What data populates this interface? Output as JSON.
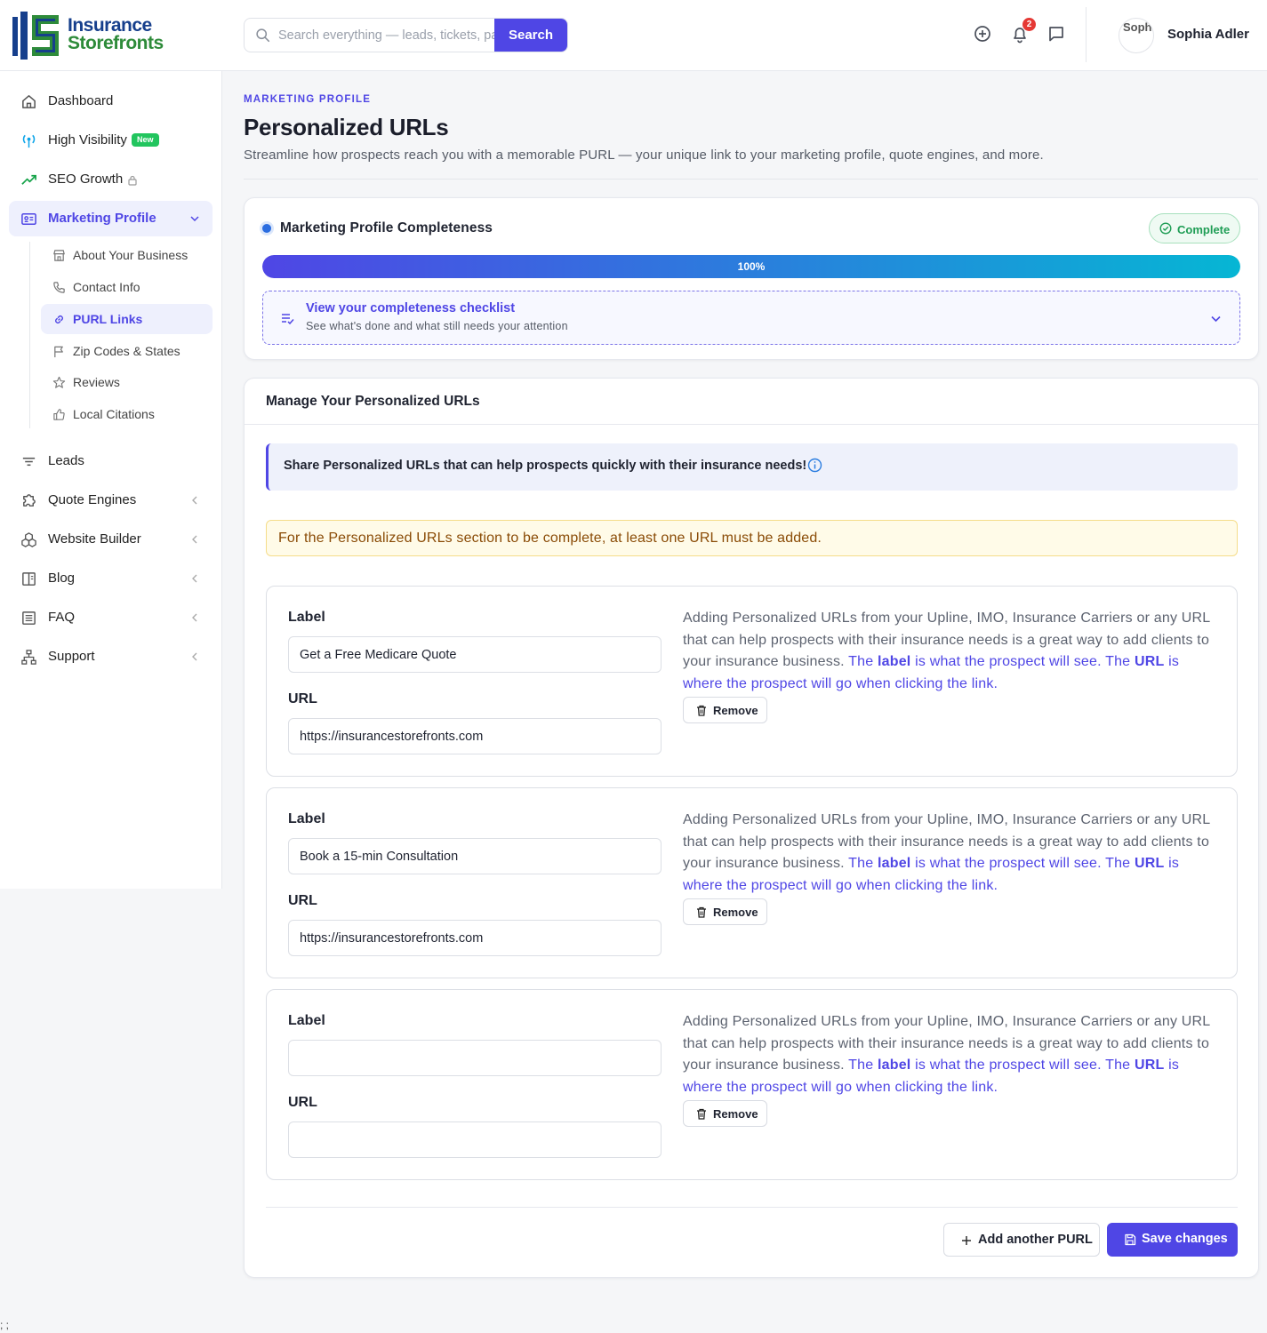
{
  "brand": {
    "line1": "Insurance",
    "line2": "Storefronts"
  },
  "search": {
    "placeholder": "Search everything — leads, tickets, pages",
    "button": "Search"
  },
  "header": {
    "notification_count": "2",
    "avatar_alt": "Sophia Adler",
    "user_name": "Sophia Adler"
  },
  "sidebar": {
    "items": [
      {
        "label": "Dashboard",
        "icon": "home-icon"
      },
      {
        "label": "High Visibility",
        "icon": "broadcast-icon",
        "badge": "New"
      },
      {
        "label": "SEO Growth",
        "icon": "trending-up-icon",
        "locked": true
      },
      {
        "label": "Marketing Profile",
        "icon": "id-card-icon",
        "active": true
      },
      {
        "label": "Leads",
        "icon": "filter-icon"
      },
      {
        "label": "Quote Engines",
        "icon": "puzzle-icon"
      },
      {
        "label": "Website Builder",
        "icon": "blocks-icon"
      },
      {
        "label": "Blog",
        "icon": "book-icon"
      },
      {
        "label": "FAQ",
        "icon": "list-icon"
      },
      {
        "label": "Support",
        "icon": "sitemap-icon"
      }
    ],
    "sub_items": [
      {
        "label": "About Your Business",
        "icon": "store-icon"
      },
      {
        "label": "Contact Info",
        "icon": "phone-icon"
      },
      {
        "label": "PURL Links",
        "icon": "link-icon",
        "active": true
      },
      {
        "label": "Zip Codes & States",
        "icon": "flag-icon"
      },
      {
        "label": "Reviews",
        "icon": "star-icon"
      },
      {
        "label": "Local Citations",
        "icon": "thumbs-up-icon"
      }
    ]
  },
  "page": {
    "eyebrow": "MARKETING PROFILE",
    "title": "Personalized URLs",
    "subtitle": "Streamline how prospects reach you with a memorable PURL — your unique link to your marketing profile, quote engines, and more."
  },
  "completeness": {
    "title": "Marketing Profile Completeness",
    "status": "Complete",
    "progress": 100,
    "progress_label": "100%",
    "checklist_title": "View your completeness checklist",
    "checklist_sub": "See what's done and what still needs your attention"
  },
  "manage": {
    "title": "Manage Your Personalized URLs",
    "info": "Share Personalized URLs that can help prospects quickly with their insurance needs!",
    "warning": "For the Personalized URLs section to be complete, at least one URL must be added.",
    "label_heading": "Label",
    "url_heading": "URL",
    "help_text": "Adding Personalized URLs from your Upline, IMO, Insurance Carriers or any URL that can help prospects with their insurance needs is a great way to add clients to your insurance business.",
    "help_the1": "The",
    "help_label_word": "label",
    "help_mid": "is what the prospect will see. The",
    "help_url_word": "URL",
    "help_end": "is where the prospect will go when clicking the link.",
    "remove_label": "Remove",
    "purls": [
      {
        "label": "Get a Free Medicare Quote",
        "url": "https://insurancestorefronts.com"
      },
      {
        "label": "Book a 15-min Consultation",
        "url": "https://insurancestorefronts.com"
      },
      {
        "label": "",
        "url": ""
      }
    ],
    "add_button": "Add another PURL",
    "save_button": "Save changes"
  },
  "stray_text": "; ;",
  "colors": {
    "accent": "#4f46e5",
    "success": "#1f9d55",
    "warning_text": "#8a4b06",
    "brand_blue": "#163f8c",
    "brand_green": "#2e8b3a"
  }
}
